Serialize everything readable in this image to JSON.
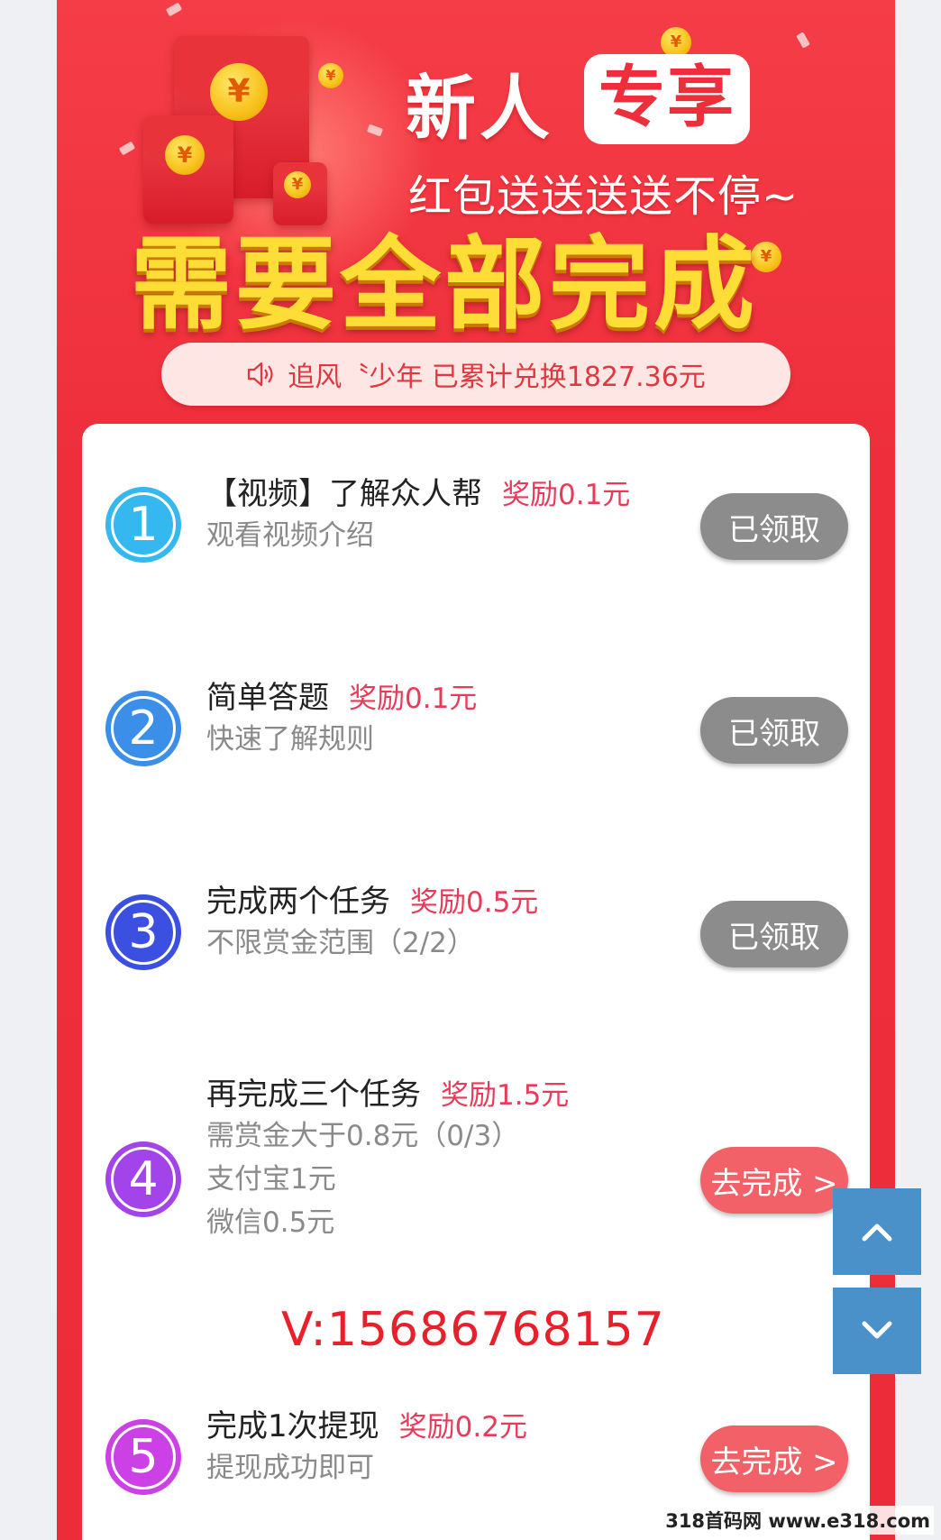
{
  "banner": {
    "title_part1": "新人",
    "title_part2": "专享",
    "subtitle": "红包送送送送不停~",
    "overlay_text": "需要全部完成",
    "coin_symbol": "¥"
  },
  "notice": {
    "icon": "speaker-icon",
    "text": "追风〝少年 已累计兑换1827.36元"
  },
  "tasks": [
    {
      "number": "1",
      "title": "【视频】了解众人帮",
      "reward": "奖励0.1元",
      "desc": [
        "观看视频介绍"
      ],
      "button": "已领取",
      "status": "done",
      "color": "#35b8ef"
    },
    {
      "number": "2",
      "title": "简单答题",
      "reward": "奖励0.1元",
      "desc": [
        "快速了解规则"
      ],
      "button": "已领取",
      "status": "done",
      "color": "#3b8fe8"
    },
    {
      "number": "3",
      "title": "完成两个任务",
      "reward": "奖励0.5元",
      "desc": [
        "不限赏金范围（2/2）"
      ],
      "button": "已领取",
      "status": "done",
      "color": "#3b4fe0"
    },
    {
      "number": "4",
      "title": "再完成三个任务",
      "reward": "奖励1.5元",
      "desc": [
        "需赏金大于0.8元（0/3）",
        "支付宝1元",
        "微信0.5元"
      ],
      "button": "去完成 >",
      "status": "todo",
      "color": "#a343ea"
    },
    {
      "number": "5",
      "title": "完成1次提现",
      "reward": "奖励0.2元",
      "desc": [
        "提现成功即可"
      ],
      "button": "去完成 >",
      "status": "todo",
      "color": "#cc41e6"
    }
  ],
  "contact_overlay": "V:15686768157",
  "scroll": {
    "up_icon": "chevron-up-icon",
    "down_icon": "chevron-down-icon"
  },
  "watermark": "318首码网 www.e318.com",
  "colors": {
    "background": "#ee2f3b",
    "accent": "#e83b5b",
    "done_button": "#8c8c8c",
    "todo_button": "#f16167",
    "scroll_button": "#4a90c9",
    "gold": "#ffdd37"
  }
}
